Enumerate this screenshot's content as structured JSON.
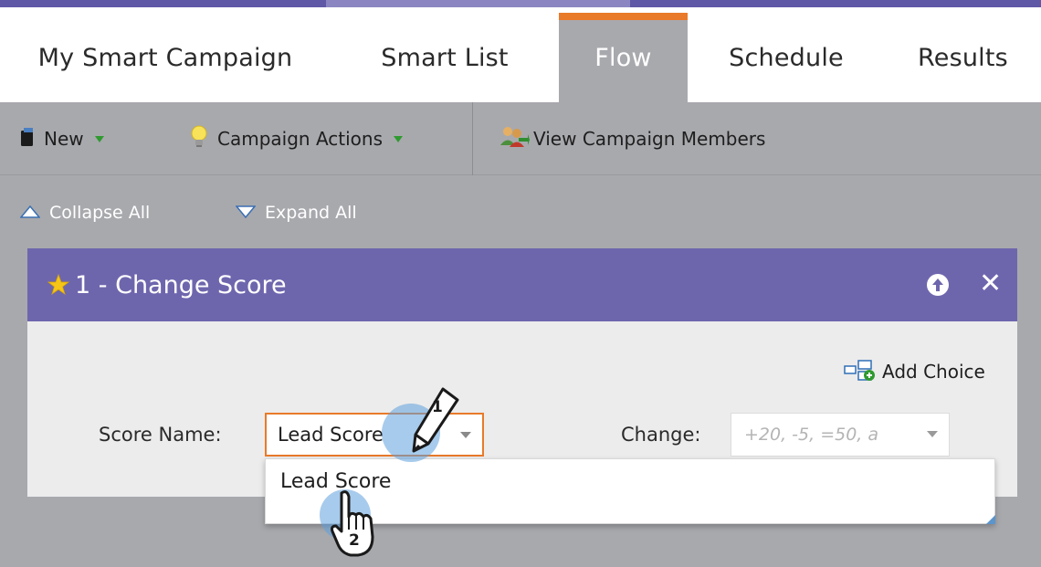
{
  "colors": {
    "top_bar_left": "#5e58a6",
    "top_bar_mid": "#8b86c2",
    "active_tab_accent": "#e87a2a",
    "gray_background": "#a8a9ad",
    "panel_header": "#6e66ad",
    "panel_body": "#ececec",
    "focus_border": "#e87a2a",
    "tap_highlight": "#5fa0dc"
  },
  "tabs": [
    {
      "label": "My Smart Campaign",
      "active": false
    },
    {
      "label": "Smart List",
      "active": false
    },
    {
      "label": "Flow",
      "active": true
    },
    {
      "label": "Schedule",
      "active": false
    },
    {
      "label": "Results",
      "active": false
    }
  ],
  "toolbar": {
    "new_label": "New",
    "new_icon": "document-icon",
    "campaign_actions_label": "Campaign Actions",
    "campaign_actions_icon": "lightbulb-icon",
    "view_members_label": "View Campaign Members",
    "view_members_icon": "people-icon"
  },
  "flow_controls": {
    "collapse_all": "Collapse All",
    "expand_all": "Expand All"
  },
  "flow_step": {
    "title": "1 - Change Score",
    "star_icon": "star-icon",
    "move_up_icon": "arrow-up-icon",
    "remove_icon": "close-icon",
    "add_choice_label": "Add Choice",
    "add_choice_icon": "add-choice-icon",
    "score_name_label": "Score Name:",
    "score_name_value": "Lead Score",
    "change_label": "Change:",
    "change_placeholder": "+20, -5, =50, a",
    "dropdown_options": [
      "Lead Score"
    ]
  },
  "callouts": {
    "step1_number": "1",
    "step1_icon": "pencil-icon",
    "step2_number": "2",
    "step2_icon": "hand-pointer-icon"
  }
}
